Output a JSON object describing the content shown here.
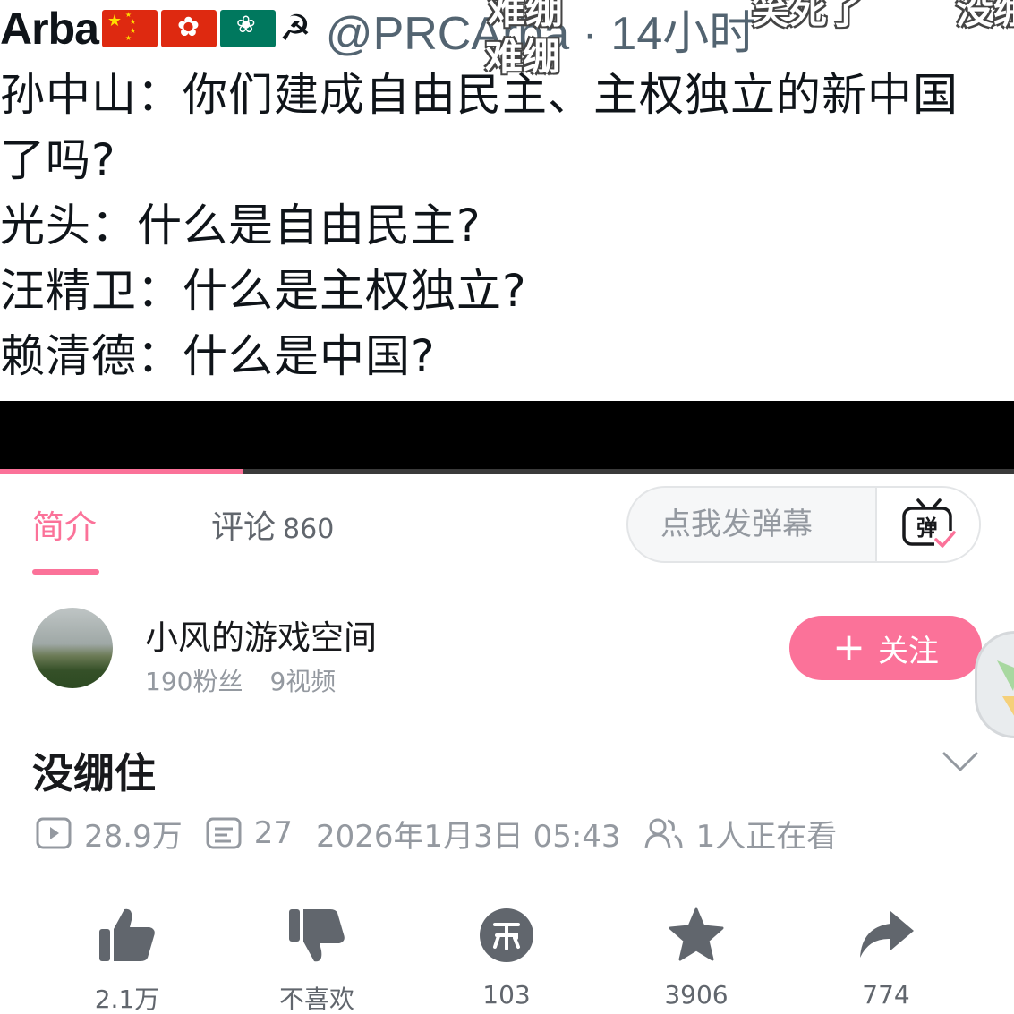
{
  "video": {
    "tweet": {
      "name": "Arba",
      "handle": "@PRCArba · 14小时",
      "lines": [
        "孙中山：你们建成自由民主、主权独立的新中国",
        "了吗?",
        "光头：什么是自由民主?",
        "汪精卫：什么是主权独立?",
        "赖清德：什么是中国?"
      ]
    },
    "danmaku_overlays": [
      "难绷",
      "难绷",
      "笑死了",
      "没绷"
    ],
    "progress_fraction": 0.24
  },
  "tabs": {
    "intro_label": "简介",
    "comments_label": "评论",
    "comments_count": "860",
    "danmaku_placeholder": "点我发弹幕",
    "danmaku_button_glyph": "弹"
  },
  "uploader": {
    "name": "小风的游戏空间",
    "fans": "190粉丝",
    "videos": "9视频",
    "follow_label": "关注"
  },
  "video_info": {
    "title": "没绷住",
    "views": "28.9万",
    "danmaku_count": "27",
    "published": "2026年1月3日 05:43",
    "watching": "1人正在看"
  },
  "actions": {
    "like": "2.1万",
    "dislike": "不喜欢",
    "coin": "103",
    "favorite": "3906",
    "share": "774"
  },
  "colors": {
    "accent": "#fb7299",
    "text_secondary": "#9499a0",
    "icon_gray": "#61666d"
  }
}
